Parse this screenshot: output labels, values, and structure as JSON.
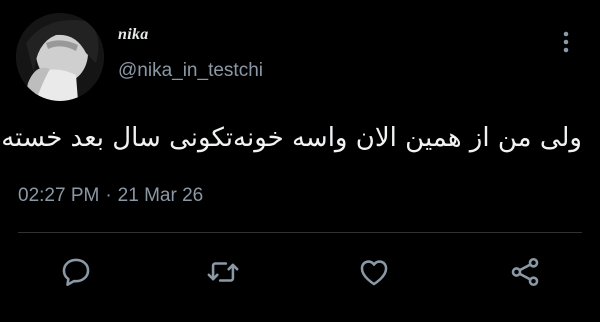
{
  "tweet": {
    "display_name": "nika",
    "handle": "@nika_in_testchi",
    "text": "ولی من از همین الان واسه خونه‌تکونی سال بعد خسته‌م",
    "time": "02:27 PM",
    "separator": "·",
    "date": "21 Mar 26"
  },
  "icons": {
    "more": "more-vertical-icon",
    "reply": "reply-icon",
    "retweet": "retweet-icon",
    "like": "heart-icon",
    "share": "share-icon"
  },
  "colors": {
    "background": "#000000",
    "text": "#e7e9ea",
    "secondary": "#8b98a5",
    "divider": "#2f3336"
  }
}
